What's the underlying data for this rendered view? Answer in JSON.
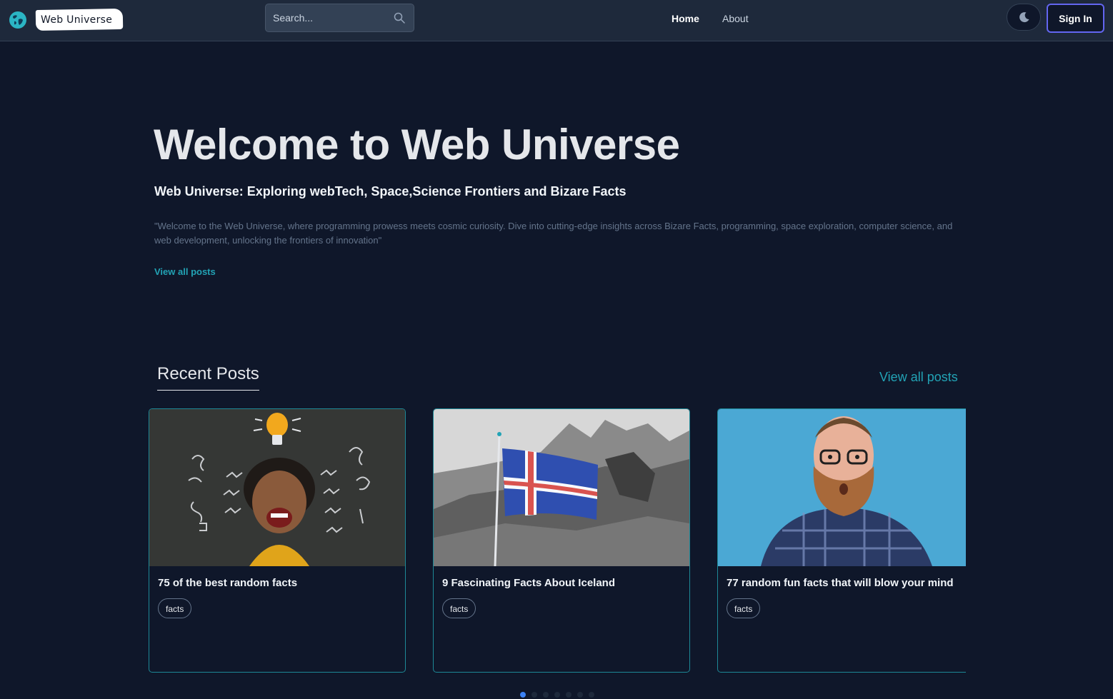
{
  "header": {
    "logo_text": "Web Universe",
    "search_placeholder": "Search...",
    "nav": [
      {
        "label": "Home"
      },
      {
        "label": "About"
      }
    ],
    "signin_label": "Sign In"
  },
  "hero": {
    "title": "Welcome to Web Universe",
    "subtitle": "Web Universe: Exploring webTech, Space,Science Frontiers and Bizare Facts",
    "description": "\"Welcome to the Web Universe, where programming prowess meets cosmic curiosity. Dive into cutting-edge insights across Bizare Facts, programming, space exploration, computer science, and web development, unlocking the frontiers of innovation\"",
    "link_label": "View all posts"
  },
  "recent": {
    "title": "Recent Posts",
    "link_label": "View all posts",
    "posts": [
      {
        "title": "75 of the best random facts",
        "tag": "facts"
      },
      {
        "title": "9 Fascinating Facts About Iceland",
        "tag": "facts"
      },
      {
        "title": "77 random fun facts that will blow your mind",
        "tag": "facts"
      }
    ],
    "active_slide": 1,
    "slide_count": 7
  },
  "colors": {
    "background": "#0f172a",
    "header": "#1e293b",
    "accent": "#22a3b5",
    "signin_border": "#6366f1",
    "card_border": "#1d8896"
  }
}
